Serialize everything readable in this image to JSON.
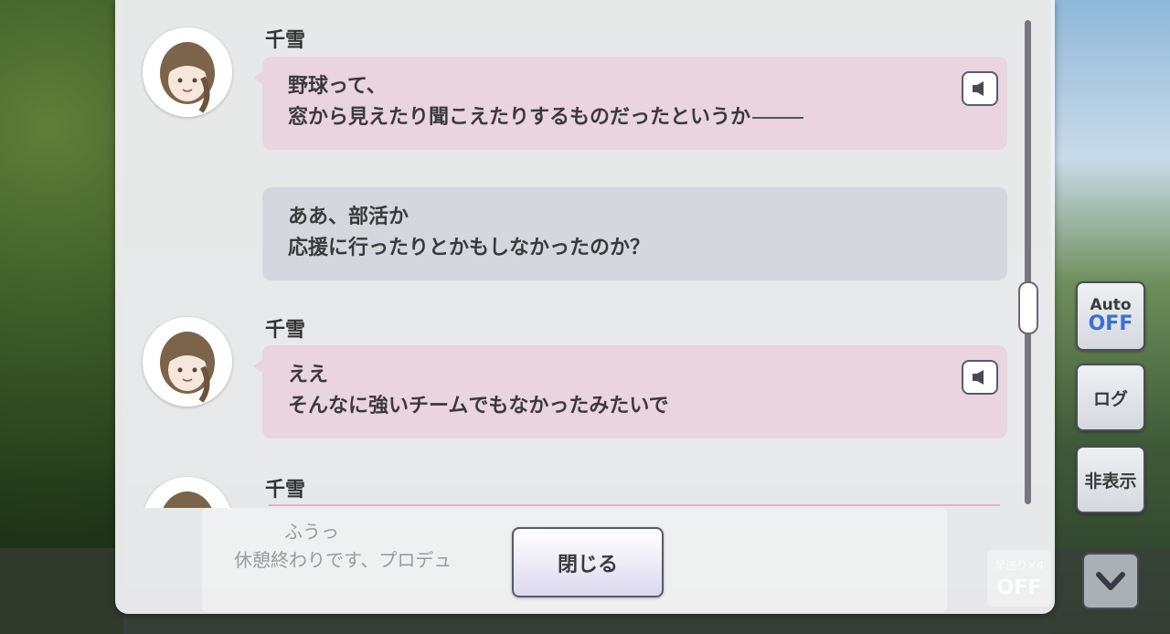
{
  "log": {
    "entries": [
      {
        "speaker": "千雪",
        "lines": [
          "野球って、",
          "窓から見えたり聞こえたりするものだったというか"
        ],
        "style": "pink",
        "has_voice": true
      },
      {
        "speaker": "",
        "lines": [
          "ああ、部活か",
          "応援に行ったりとかもしなかったのか？"
        ],
        "style": "gray",
        "has_voice": false
      },
      {
        "speaker": "千雪",
        "lines": [
          "ええ",
          "そんなに強いチームでもなかったみたいで"
        ],
        "style": "pink",
        "has_voice": true
      },
      {
        "speaker": "千雪",
        "lines": [],
        "style": "pink",
        "has_voice": false
      }
    ],
    "close_label": "閉じる"
  },
  "background_dialogue": {
    "line1": "ふうっ",
    "line2": "休憩終わりです、プロデュ"
  },
  "side_buttons": {
    "auto_top": "Auto",
    "auto_state": "OFF",
    "log_label": "ログ",
    "hide_label": "非表示"
  },
  "fast_forward": {
    "label": "早送り×4",
    "state": "OFF"
  },
  "colors": {
    "speaker_bubble": "#ead4de",
    "player_bubble": "#d4d7dd",
    "auto_off": "#3c6fd0"
  }
}
